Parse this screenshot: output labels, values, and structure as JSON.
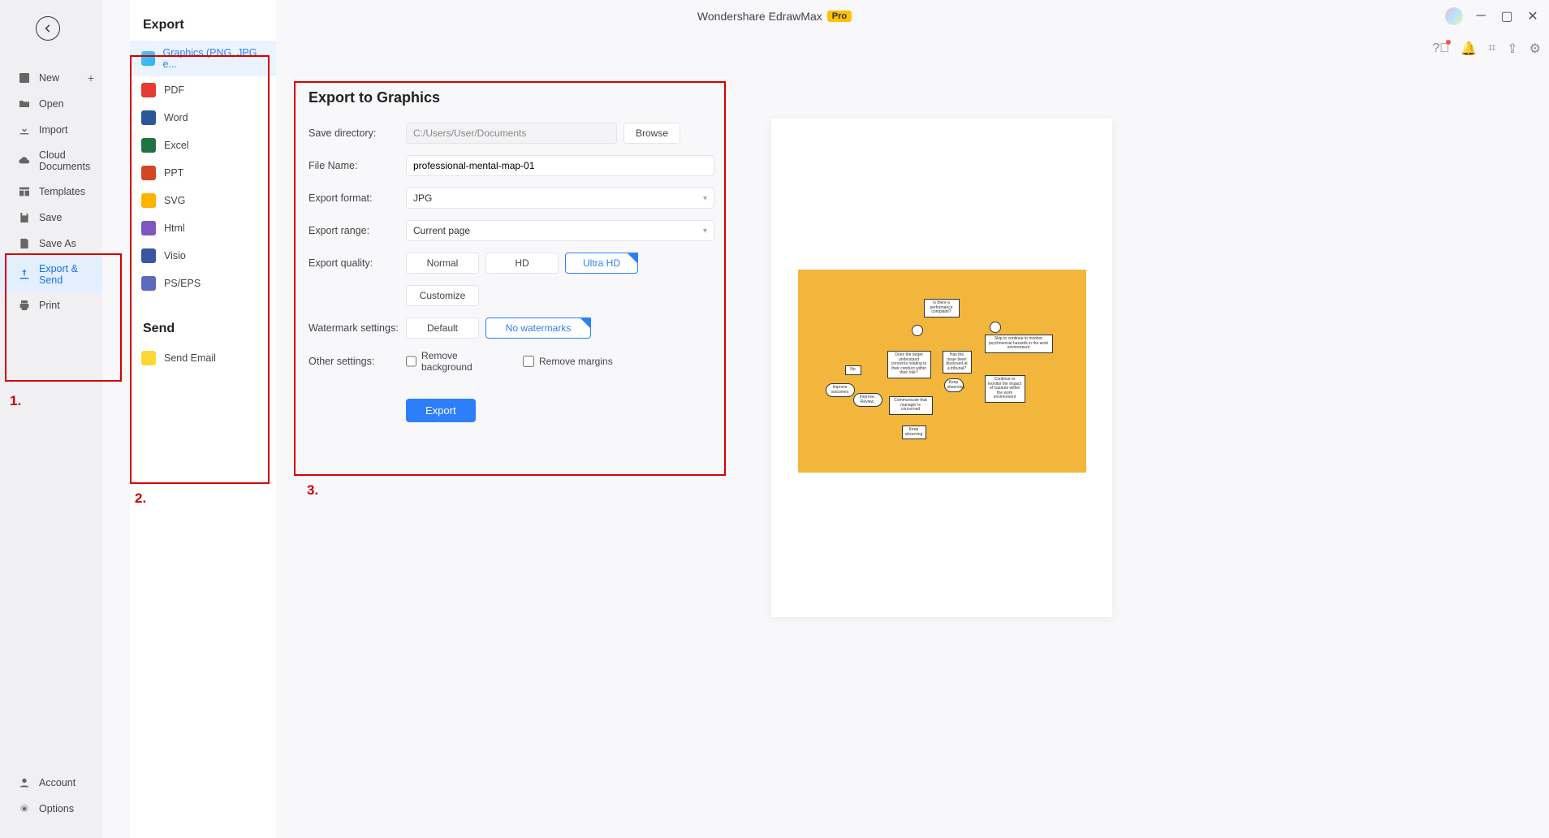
{
  "app": {
    "title": "Wondershare EdrawMax",
    "badge": "Pro"
  },
  "nav": {
    "new": "New",
    "open": "Open",
    "import": "Import",
    "cloud": "Cloud Documents",
    "templates": "Templates",
    "save": "Save",
    "saveas": "Save As",
    "exportsend": "Export & Send",
    "print": "Print",
    "account": "Account",
    "options": "Options"
  },
  "export": {
    "heading": "Export",
    "graphics": "Graphics (PNG, JPG e...",
    "pdf": "PDF",
    "word": "Word",
    "excel": "Excel",
    "ppt": "PPT",
    "svg": "SVG",
    "html": "Html",
    "visio": "Visio",
    "ps": "PS/EPS"
  },
  "send": {
    "heading": "Send",
    "email": "Send Email"
  },
  "panel": {
    "title": "Export to Graphics",
    "savedir_label": "Save directory:",
    "savedir_value": "C:/Users/User/Documents",
    "browse": "Browse",
    "filename_label": "File Name:",
    "filename_value": "professional-mental-map-01",
    "format_label": "Export format:",
    "format_value": "JPG",
    "range_label": "Export range:",
    "range_value": "Current page",
    "quality_label": "Export quality:",
    "quality_normal": "Normal",
    "quality_hd": "HD",
    "quality_uhd": "Ultra HD",
    "customize": "Customize",
    "watermark_label": "Watermark settings:",
    "watermark_default": "Default",
    "watermark_none": "No watermarks",
    "other_label": "Other settings:",
    "remove_bg": "Remove background",
    "remove_margins": "Remove margins",
    "export_btn": "Export"
  },
  "labels": {
    "l1": "1.",
    "l2": "2.",
    "l3": "3."
  }
}
